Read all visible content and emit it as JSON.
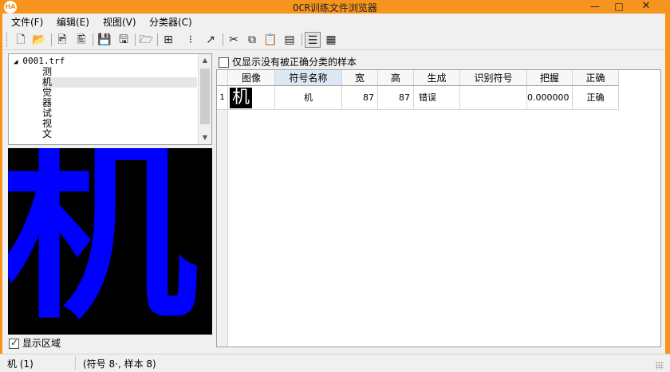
{
  "window": {
    "title": "OCR训练文件浏览器",
    "app_icon_text": "HA",
    "minimize": "—",
    "maximize": "□",
    "close": "✕"
  },
  "menu": [
    {
      "label": "文件(F)"
    },
    {
      "label": "编辑(E)"
    },
    {
      "label": "视图(V)"
    },
    {
      "label": "分类器(C)"
    }
  ],
  "toolbar": {
    "buttons": [
      {
        "icon": "new-file-icon",
        "glyph": "🗋"
      },
      {
        "icon": "open-folder-icon",
        "glyph": "📂"
      },
      {
        "icon": "image-file-icon",
        "glyph": "🖻"
      },
      {
        "icon": "image-edit-icon",
        "glyph": "🖺"
      },
      {
        "icon": "save-icon",
        "glyph": "💾"
      },
      {
        "icon": "save-all-icon",
        "glyph": "🖫"
      },
      {
        "icon": "folder-open-icon",
        "glyph": "🗁"
      },
      {
        "icon": "add-item-icon",
        "glyph": "⊞"
      },
      {
        "icon": "abc-icon",
        "glyph": "⁝"
      },
      {
        "icon": "connect-icon",
        "glyph": "↗"
      },
      {
        "icon": "cut-icon",
        "glyph": "✂"
      },
      {
        "icon": "copy-icon",
        "glyph": "⧉"
      },
      {
        "icon": "paste-icon",
        "glyph": "📋"
      },
      {
        "icon": "properties-icon",
        "glyph": "▤"
      },
      {
        "icon": "list-view-icon",
        "glyph": "☰"
      },
      {
        "icon": "grid-view-icon",
        "glyph": "▦"
      }
    ]
  },
  "tree": {
    "root": "0001.trf",
    "children": [
      "测",
      "机",
      "觉",
      "器",
      "试",
      "视",
      "文"
    ],
    "selected_index": 1
  },
  "preview": {
    "glyph": "机",
    "colors": {
      "background": "#000000",
      "glyph": "#0000ff"
    }
  },
  "show_region": {
    "label": "显示区域",
    "checked": true
  },
  "filter": {
    "label": "仅显示没有被正确分类的样本",
    "checked": false
  },
  "grid": {
    "headers": [
      "图像",
      "符号名称",
      "宽",
      "高",
      "生成",
      "识别符号",
      "把握",
      "正确"
    ],
    "selected_header_index": 1,
    "rows": [
      {
        "index": "1",
        "image": "机",
        "symbol": "机",
        "width": "87",
        "height": "87",
        "generated": "错误",
        "recognized": "",
        "confidence": "0.000000",
        "correct": "正确"
      }
    ]
  },
  "status": {
    "left": "机 (1)",
    "mid": "(符号 8·, 样本 8)"
  }
}
